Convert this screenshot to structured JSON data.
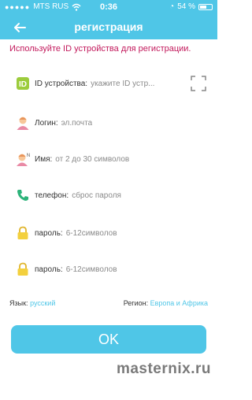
{
  "status_bar": {
    "carrier": "MTS RUS",
    "time": "0:36",
    "battery": "54 %"
  },
  "header": {
    "title": "регистрация",
    "back_icon": "arrow-left-icon"
  },
  "notice": "Используйте ID устройства для регистрации.",
  "form": {
    "device_id": {
      "label": "ID устройства:",
      "placeholder": "укажите ID устр..."
    },
    "login": {
      "label": "Логин:",
      "placeholder": "эл.почта"
    },
    "name": {
      "label": "Имя:",
      "placeholder": "от 2 до 30 символов"
    },
    "phone": {
      "label": "телефон:",
      "placeholder": "сброс пароля"
    },
    "password1": {
      "label": "пароль:",
      "placeholder": "6-12символов"
    },
    "password2": {
      "label": "пароль:",
      "placeholder": "6-12символов"
    }
  },
  "settings": {
    "language_label": "Язык:",
    "language_value": "русский",
    "region_label": "Регион:",
    "region_value": "Европа и Африка"
  },
  "ok_button": "OK",
  "watermark": "masternix.ru",
  "colors": {
    "accent": "#4fc6e7",
    "notice": "#c2185b"
  }
}
